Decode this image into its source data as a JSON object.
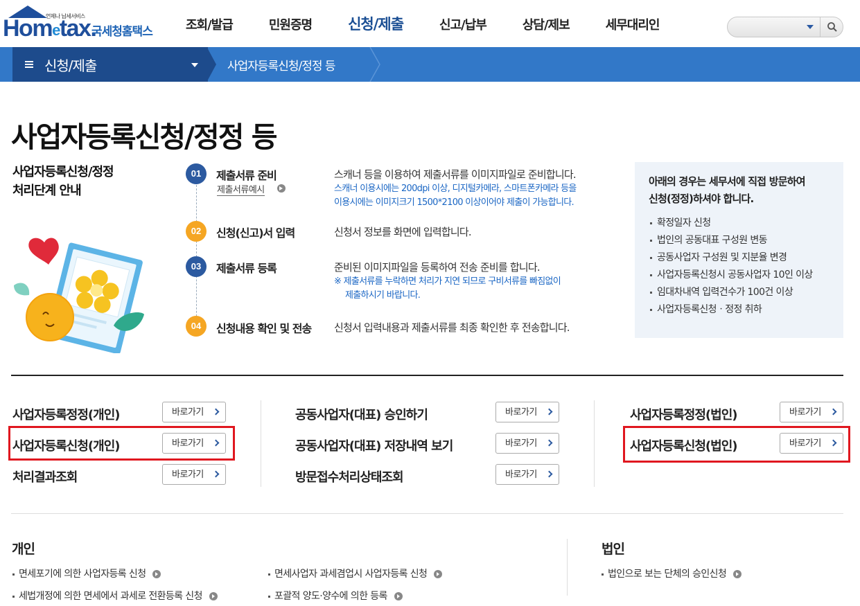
{
  "header": {
    "logo_small": "언제나 납세서비스",
    "logo_main_a": "Hom",
    "logo_main_e": "e",
    "logo_main_b": "tax.",
    "logo_kor": "국세청홈택스",
    "nav": [
      "조회/발급",
      "민원증명",
      "신청/제출",
      "신고/납부",
      "상담/제보",
      "세무대리인"
    ],
    "search_placeholder": ""
  },
  "location": {
    "menu": "신청/제출",
    "current": "사업자등록신청/정정 등"
  },
  "page_title": "사업자등록신청/정정 등",
  "guide": {
    "title_line1": "사업자등록신청/정정",
    "title_line2": "처리단계 안내",
    "steps": [
      {
        "num": "01",
        "name": "제출서류 준비",
        "link": "제출서류예시",
        "desc": "스캐너 등을 이용하여 제출서류를 이미지파일로 준비합니다.",
        "note_line1": "스캐너 이용시에는 200dpi 이상, 디지털카메라, 스마트폰카메라 등을",
        "note_line2": "이용시에는 이미지크기 1500*2100 이상이어야 제출이 가능합니다."
      },
      {
        "num": "02",
        "name": "신청(신고)서 입력",
        "desc": "신청서 정보를 화면에 입력합니다."
      },
      {
        "num": "03",
        "name": "제출서류 등록",
        "desc": "준비된 이미지파일을 등록하여 전송 준비를 합니다.",
        "note_line1": "※ 제출서류를 누락하면 처리가 지연 되므로 구비서류를 빠짐없이",
        "note_line2": "제출하시기 바랍니다."
      },
      {
        "num": "04",
        "name": "신청내용 확인 및 전송",
        "desc": "신청서 입력내용과 제출서류를 최종 확인한 후 전송합니다."
      }
    ]
  },
  "visit": {
    "title_line1": "아래의 경우는 세무서에 직접 방문하여",
    "title_line2": "신청(정정)하셔야 합니다.",
    "items": [
      "확정일자 신청",
      "법인의 공동대표 구성원 변동",
      "공동사업자 구성원 및 지분율 변경",
      "사업자등록신청시 공동사업자 10인 이상",
      "임대차내역 입력건수가 100건 이상",
      "사업자등록신청ㆍ정정 취하"
    ]
  },
  "shortcuts": {
    "button_label": "바로가기",
    "col1": [
      "사업자등록정정(개인)",
      "사업자등록신청(개인)",
      "처리결과조회"
    ],
    "col2": [
      "공동사업자(대표) 승인하기",
      "공동사업자(대표) 저장내역 보기",
      "방문접수처리상태조회"
    ],
    "col3": [
      "사업자등록정정(법인)",
      "사업자등록신청(법인)"
    ]
  },
  "sections": {
    "individual": {
      "title": "개인",
      "links": [
        "면세포기에 의한 사업자등록 신청",
        "면세사업자 과세겸업시 사업자등록 신청",
        "세법개정에 의한 면세에서 과세로 전환등록 신청",
        "포괄적 양도·양수에 의한 등록"
      ]
    },
    "corporate": {
      "title": "법인",
      "links": [
        "법인으로 보는 단체의 승인신청"
      ]
    }
  },
  "colors": {
    "brand_blue": "#1f4f9c",
    "locbar_blue": "#3278c8",
    "step_orange": "#f5a623",
    "highlight_red": "#e0171f"
  }
}
